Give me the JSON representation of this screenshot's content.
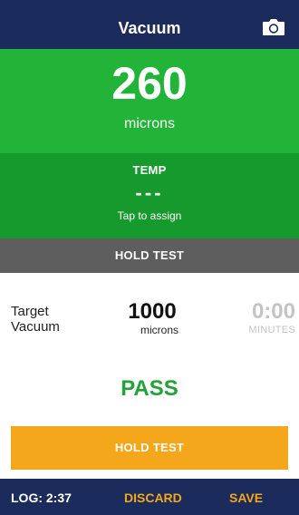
{
  "header": {
    "title": "Vacuum",
    "camera_icon": "camera-icon"
  },
  "reading": {
    "value": "260",
    "unit": "microns"
  },
  "temp": {
    "label": "TEMP",
    "value": "---",
    "hint": "Tap to assign"
  },
  "hold_test_bar": {
    "label": "HOLD TEST"
  },
  "target": {
    "label_line1": "Target",
    "label_line2": "Vacuum",
    "value": "1000",
    "unit": "microns"
  },
  "timer": {
    "value": "0:00",
    "unit": "MINUTES"
  },
  "status": {
    "text": "PASS"
  },
  "hold_test_button": {
    "label": "HOLD TEST"
  },
  "footer": {
    "log": "LOG: 2:37",
    "discard": "DISCARD",
    "save": "SAVE"
  },
  "colors": {
    "header": "#1b2b5c",
    "reading_bg": "#22b339",
    "temp_bg": "#169a2e",
    "hold_bar_bg": "#5e5e5e",
    "pass_text": "#22a33a",
    "accent_orange": "#f5a71c",
    "timer_gray": "#c4c4c4"
  }
}
